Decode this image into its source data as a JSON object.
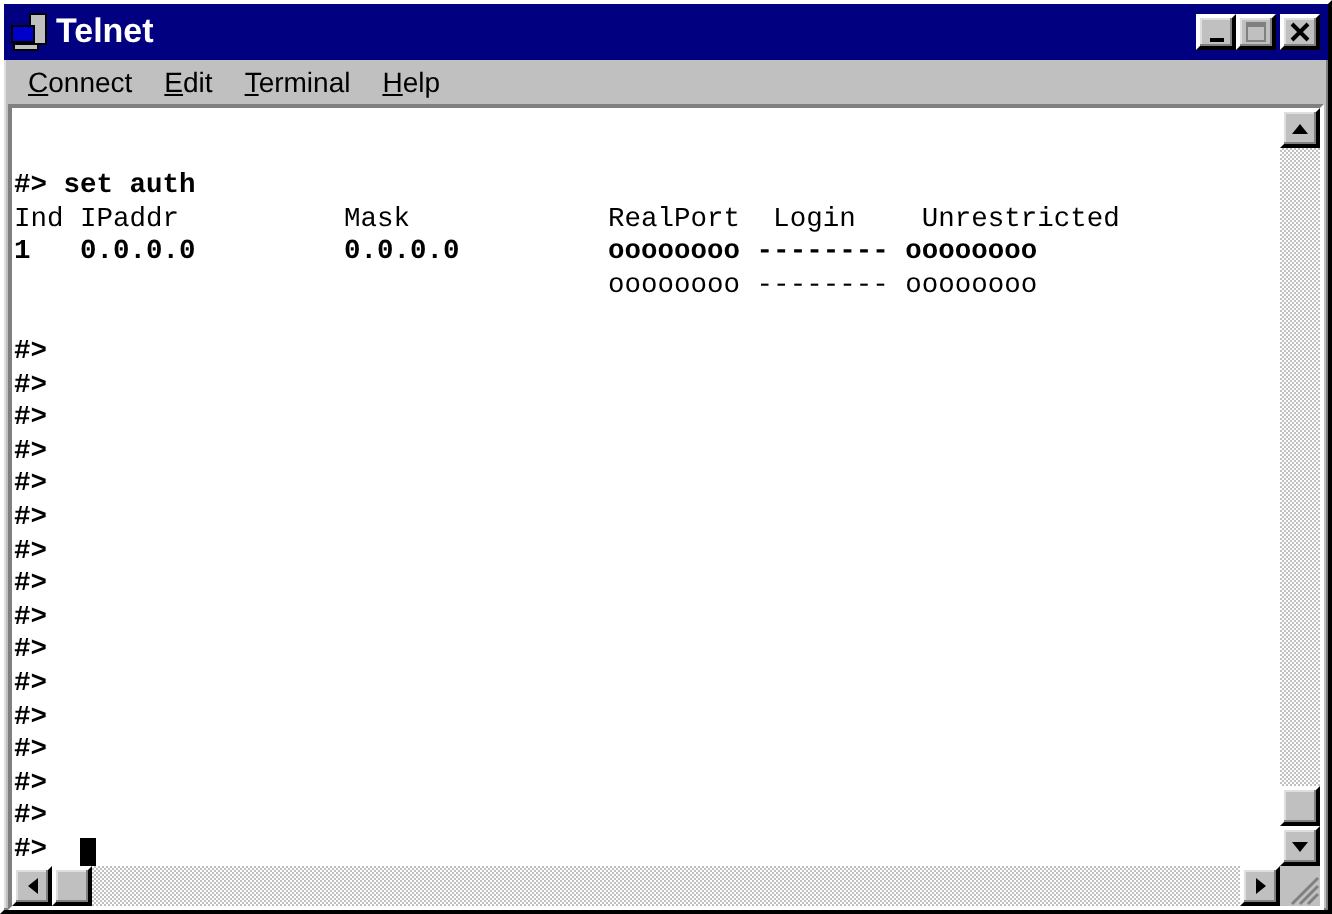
{
  "window": {
    "title": "Telnet"
  },
  "menu": [
    {
      "label": "Connect"
    },
    {
      "label": "Edit"
    },
    {
      "label": "Terminal"
    },
    {
      "label": "Help"
    }
  ],
  "terminal": {
    "lines": [
      {
        "kind": "text",
        "text": "#> set auth",
        "bold": true
      },
      {
        "kind": "text",
        "text": "Ind IPaddr          Mask            RealPort  Login    Unrestricted",
        "bold": false
      },
      {
        "kind": "text",
        "text": "1   0.0.0.0         0.0.0.0         oooooooo -------- oooooooo",
        "bold": true
      },
      {
        "kind": "text",
        "text": "                                    oooooooo -------- oooooooo",
        "bold": false
      },
      {
        "kind": "blank"
      },
      {
        "kind": "text",
        "text": "#>",
        "bold": true
      },
      {
        "kind": "text",
        "text": "#>",
        "bold": true
      },
      {
        "kind": "text",
        "text": "#>",
        "bold": true
      },
      {
        "kind": "text",
        "text": "#>",
        "bold": true
      },
      {
        "kind": "text",
        "text": "#>",
        "bold": true
      },
      {
        "kind": "text",
        "text": "#>",
        "bold": true
      },
      {
        "kind": "text",
        "text": "#>",
        "bold": true
      },
      {
        "kind": "text",
        "text": "#>",
        "bold": true
      },
      {
        "kind": "text",
        "text": "#>",
        "bold": true
      },
      {
        "kind": "text",
        "text": "#>",
        "bold": true
      },
      {
        "kind": "text",
        "text": "#>",
        "bold": true
      },
      {
        "kind": "text",
        "text": "#>",
        "bold": true
      },
      {
        "kind": "text",
        "text": "#>",
        "bold": true
      },
      {
        "kind": "text",
        "text": "#>",
        "bold": true
      },
      {
        "kind": "text",
        "text": "#>",
        "bold": true
      },
      {
        "kind": "text",
        "text": "#>",
        "bold": true,
        "cursor": true
      }
    ]
  }
}
